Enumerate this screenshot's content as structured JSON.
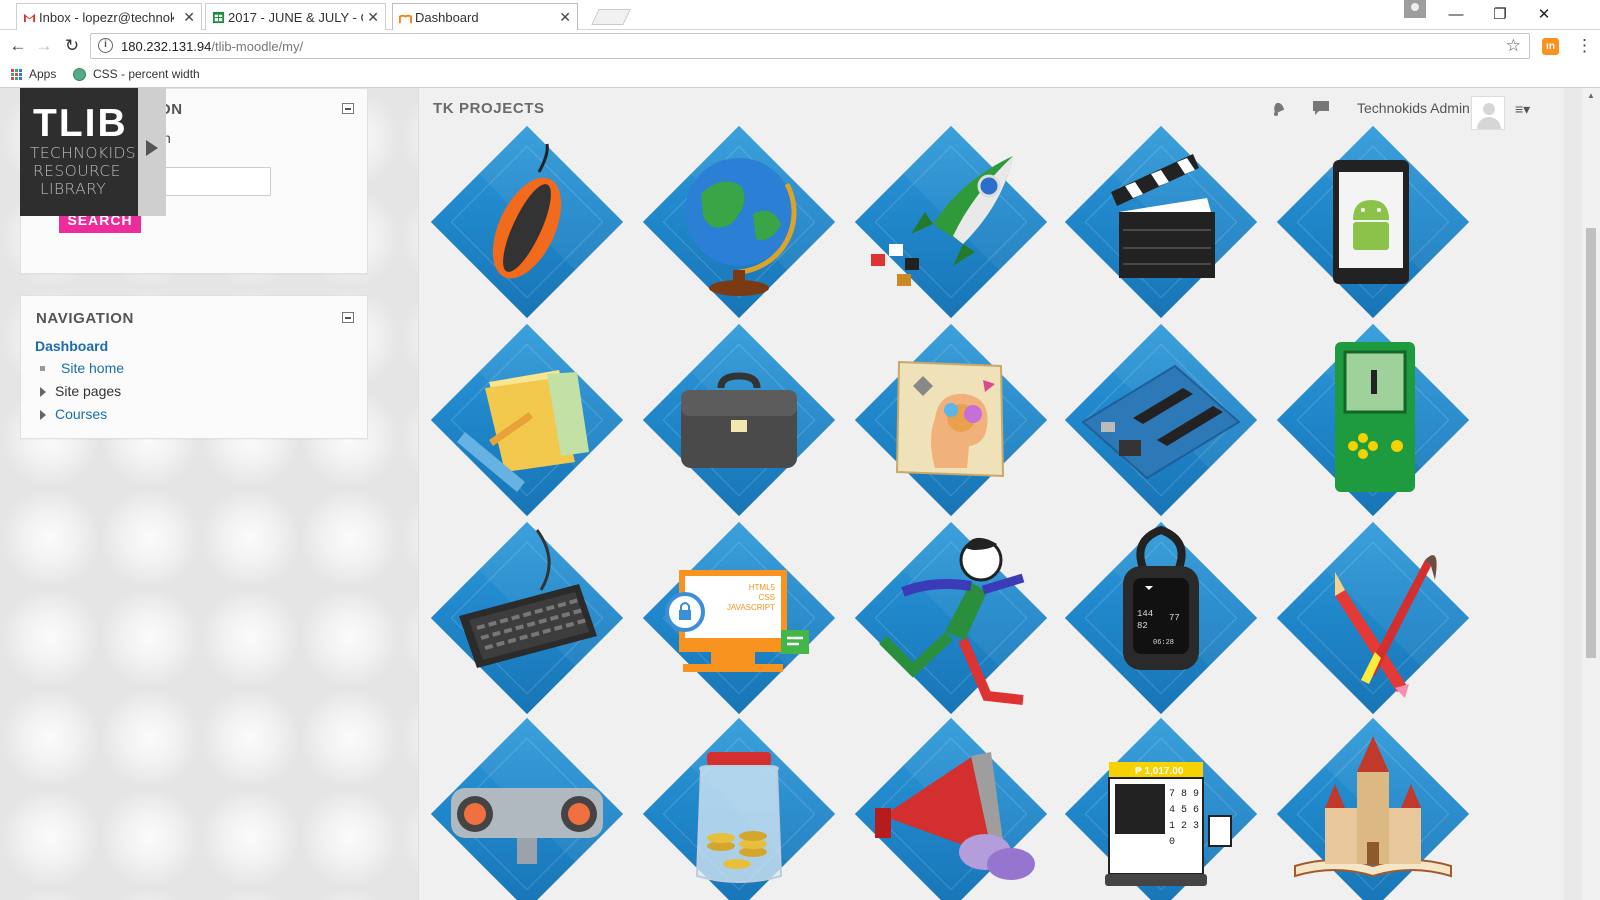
{
  "browser": {
    "tabs": [
      {
        "label": "Inbox - lopezr@technoki",
        "favicon": "gmail-icon",
        "active": false
      },
      {
        "label": "2017 - JUNE & JULY - Go",
        "favicon": "sheets-icon",
        "active": false
      },
      {
        "label": "Dashboard",
        "favicon": "moodle-icon",
        "active": true
      }
    ],
    "url_host": "180.232.131.94",
    "url_path": "/tlib-moodle/my/",
    "bookmarks": [
      {
        "label": "Apps",
        "icon": "apps-grid-icon"
      },
      {
        "label": "CSS - percent width",
        "icon": "globe-icon"
      }
    ]
  },
  "logo": {
    "big": "TLIB",
    "line1": "TECHNOKIDS",
    "line2": "RESOURCE",
    "line3": "LIBRARY"
  },
  "search_block": {
    "title_partial": "ON",
    "subtitle_partial": "n",
    "button_label": "SEARCH"
  },
  "navigation": {
    "title": "NAVIGATION",
    "dashboard": "Dashboard",
    "items": [
      {
        "label": "Site home",
        "type": "bullet"
      },
      {
        "label": "Site pages",
        "type": "expand"
      },
      {
        "label": "Courses",
        "type": "expand"
      }
    ]
  },
  "main": {
    "title": "TK PROJECTS",
    "user_name": "Technokids Admin",
    "projects": [
      {
        "name": "mouse",
        "icon": "computer-mouse-icon"
      },
      {
        "name": "globe",
        "icon": "globe-icon"
      },
      {
        "name": "rocket",
        "icon": "rocket-icon"
      },
      {
        "name": "clapperboard",
        "icon": "clapperboard-icon"
      },
      {
        "name": "android phone",
        "icon": "android-phone-icon"
      },
      {
        "name": "folders",
        "icon": "folders-icon"
      },
      {
        "name": "briefcase",
        "icon": "briefcase-icon"
      },
      {
        "name": "brain",
        "icon": "brain-icon"
      },
      {
        "name": "circuit board",
        "icon": "circuit-board-icon"
      },
      {
        "name": "handheld game",
        "icon": "handheld-game-icon"
      },
      {
        "name": "keyboard",
        "icon": "keyboard-icon"
      },
      {
        "name": "web page",
        "icon": "web-page-icon",
        "text": [
          "HTML5",
          "CSS",
          "JAVASCRIPT"
        ]
      },
      {
        "name": "runner",
        "icon": "runner-icon"
      },
      {
        "name": "smart watch",
        "icon": "smart-watch-icon",
        "text": [
          "144",
          "77",
          "82",
          "06:28"
        ]
      },
      {
        "name": "pencil and brush",
        "icon": "pencil-brush-icon"
      },
      {
        "name": "robot sensor",
        "icon": "robot-sensor-icon"
      },
      {
        "name": "coin jar",
        "icon": "coin-jar-icon"
      },
      {
        "name": "megaphone",
        "icon": "megaphone-icon"
      },
      {
        "name": "cash register",
        "icon": "cash-register-icon",
        "text": [
          "₱ 1,017.00",
          "7 8 9",
          "4 5 6",
          "1 2 3",
          "0"
        ]
      },
      {
        "name": "storybook castle",
        "icon": "castle-book-icon"
      }
    ]
  },
  "colors": {
    "accent_pink": "#ec2c9a",
    "diamond_blue": "#1f86c9",
    "link_blue": "#1a6bb0"
  }
}
